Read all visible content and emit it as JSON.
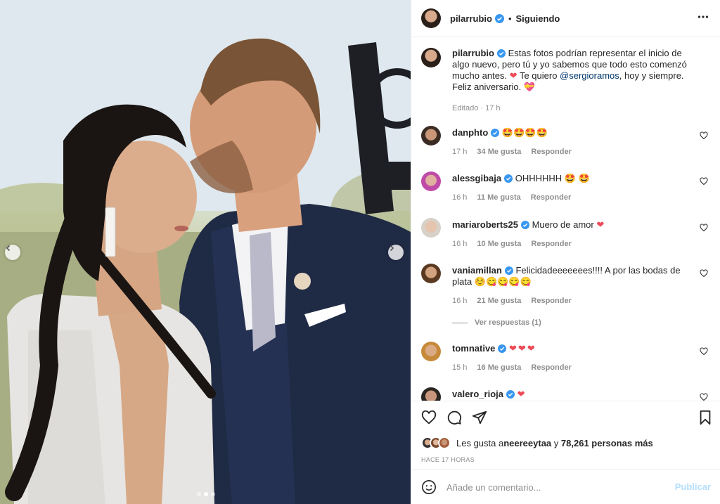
{
  "post": {
    "username": "pilarrubio",
    "separator": "•",
    "follow_label": "Siguiendo",
    "caption_pre": "Estas fotos podrían representar el inicio de algo nuevo, pero tú y yo sabemos que todo esto comenzó mucho antes.",
    "caption_mid": " Te quiero ",
    "caption_mention": "@sergioramos",
    "caption_post": ", hoy y siempre. Feliz aniversario.",
    "edited": "Editado · 17 h"
  },
  "comments": [
    {
      "user": "danphto",
      "text": "🤩🤩🤩🤩",
      "time": "17 h",
      "likes": "34 Me gusta",
      "reply": "Responder"
    },
    {
      "user": "alessgibaja",
      "text": "OHHHHHH 🤩 🤩",
      "time": "16 h",
      "likes": "11 Me gusta",
      "reply": "Responder"
    },
    {
      "user": "mariaroberts25",
      "text": "Muero de amor",
      "time": "16 h",
      "likes": "10 Me gusta",
      "reply": "Responder"
    },
    {
      "user": "vaniamillan",
      "text": "Felicidadeeeeeees!!!! A por las bodas de plata ☺️😋😋😋😋",
      "time": "16 h",
      "likes": "21 Me gusta",
      "reply": "Responder",
      "view_replies": "Ver respuestas (1)"
    },
    {
      "user": "tomnative",
      "text": "",
      "time": "15 h",
      "likes": "16 Me gusta",
      "reply": "Responder"
    },
    {
      "user": "valero_rioja",
      "text": ""
    }
  ],
  "likes": {
    "prefix": "Les gusta a ",
    "user": "neereeytaa",
    "mid": " y ",
    "count": "78,261 personas más"
  },
  "timestamp": "HACE 17 HORAS",
  "add_comment": {
    "placeholder": "Añade un comentario...",
    "publish": "Publicar"
  },
  "icons": [
    "more-icon",
    "heart-icon",
    "comment-icon",
    "share-icon",
    "bookmark-icon",
    "emoji-icon",
    "verified-badge-icon",
    "chevron-left-icon",
    "chevron-right-icon"
  ],
  "colors": {
    "verified": "#3897f0",
    "link": "#00376b",
    "muted": "#8e8e8e",
    "publish": "#b2dffc",
    "heart_red": "#ed4956"
  }
}
